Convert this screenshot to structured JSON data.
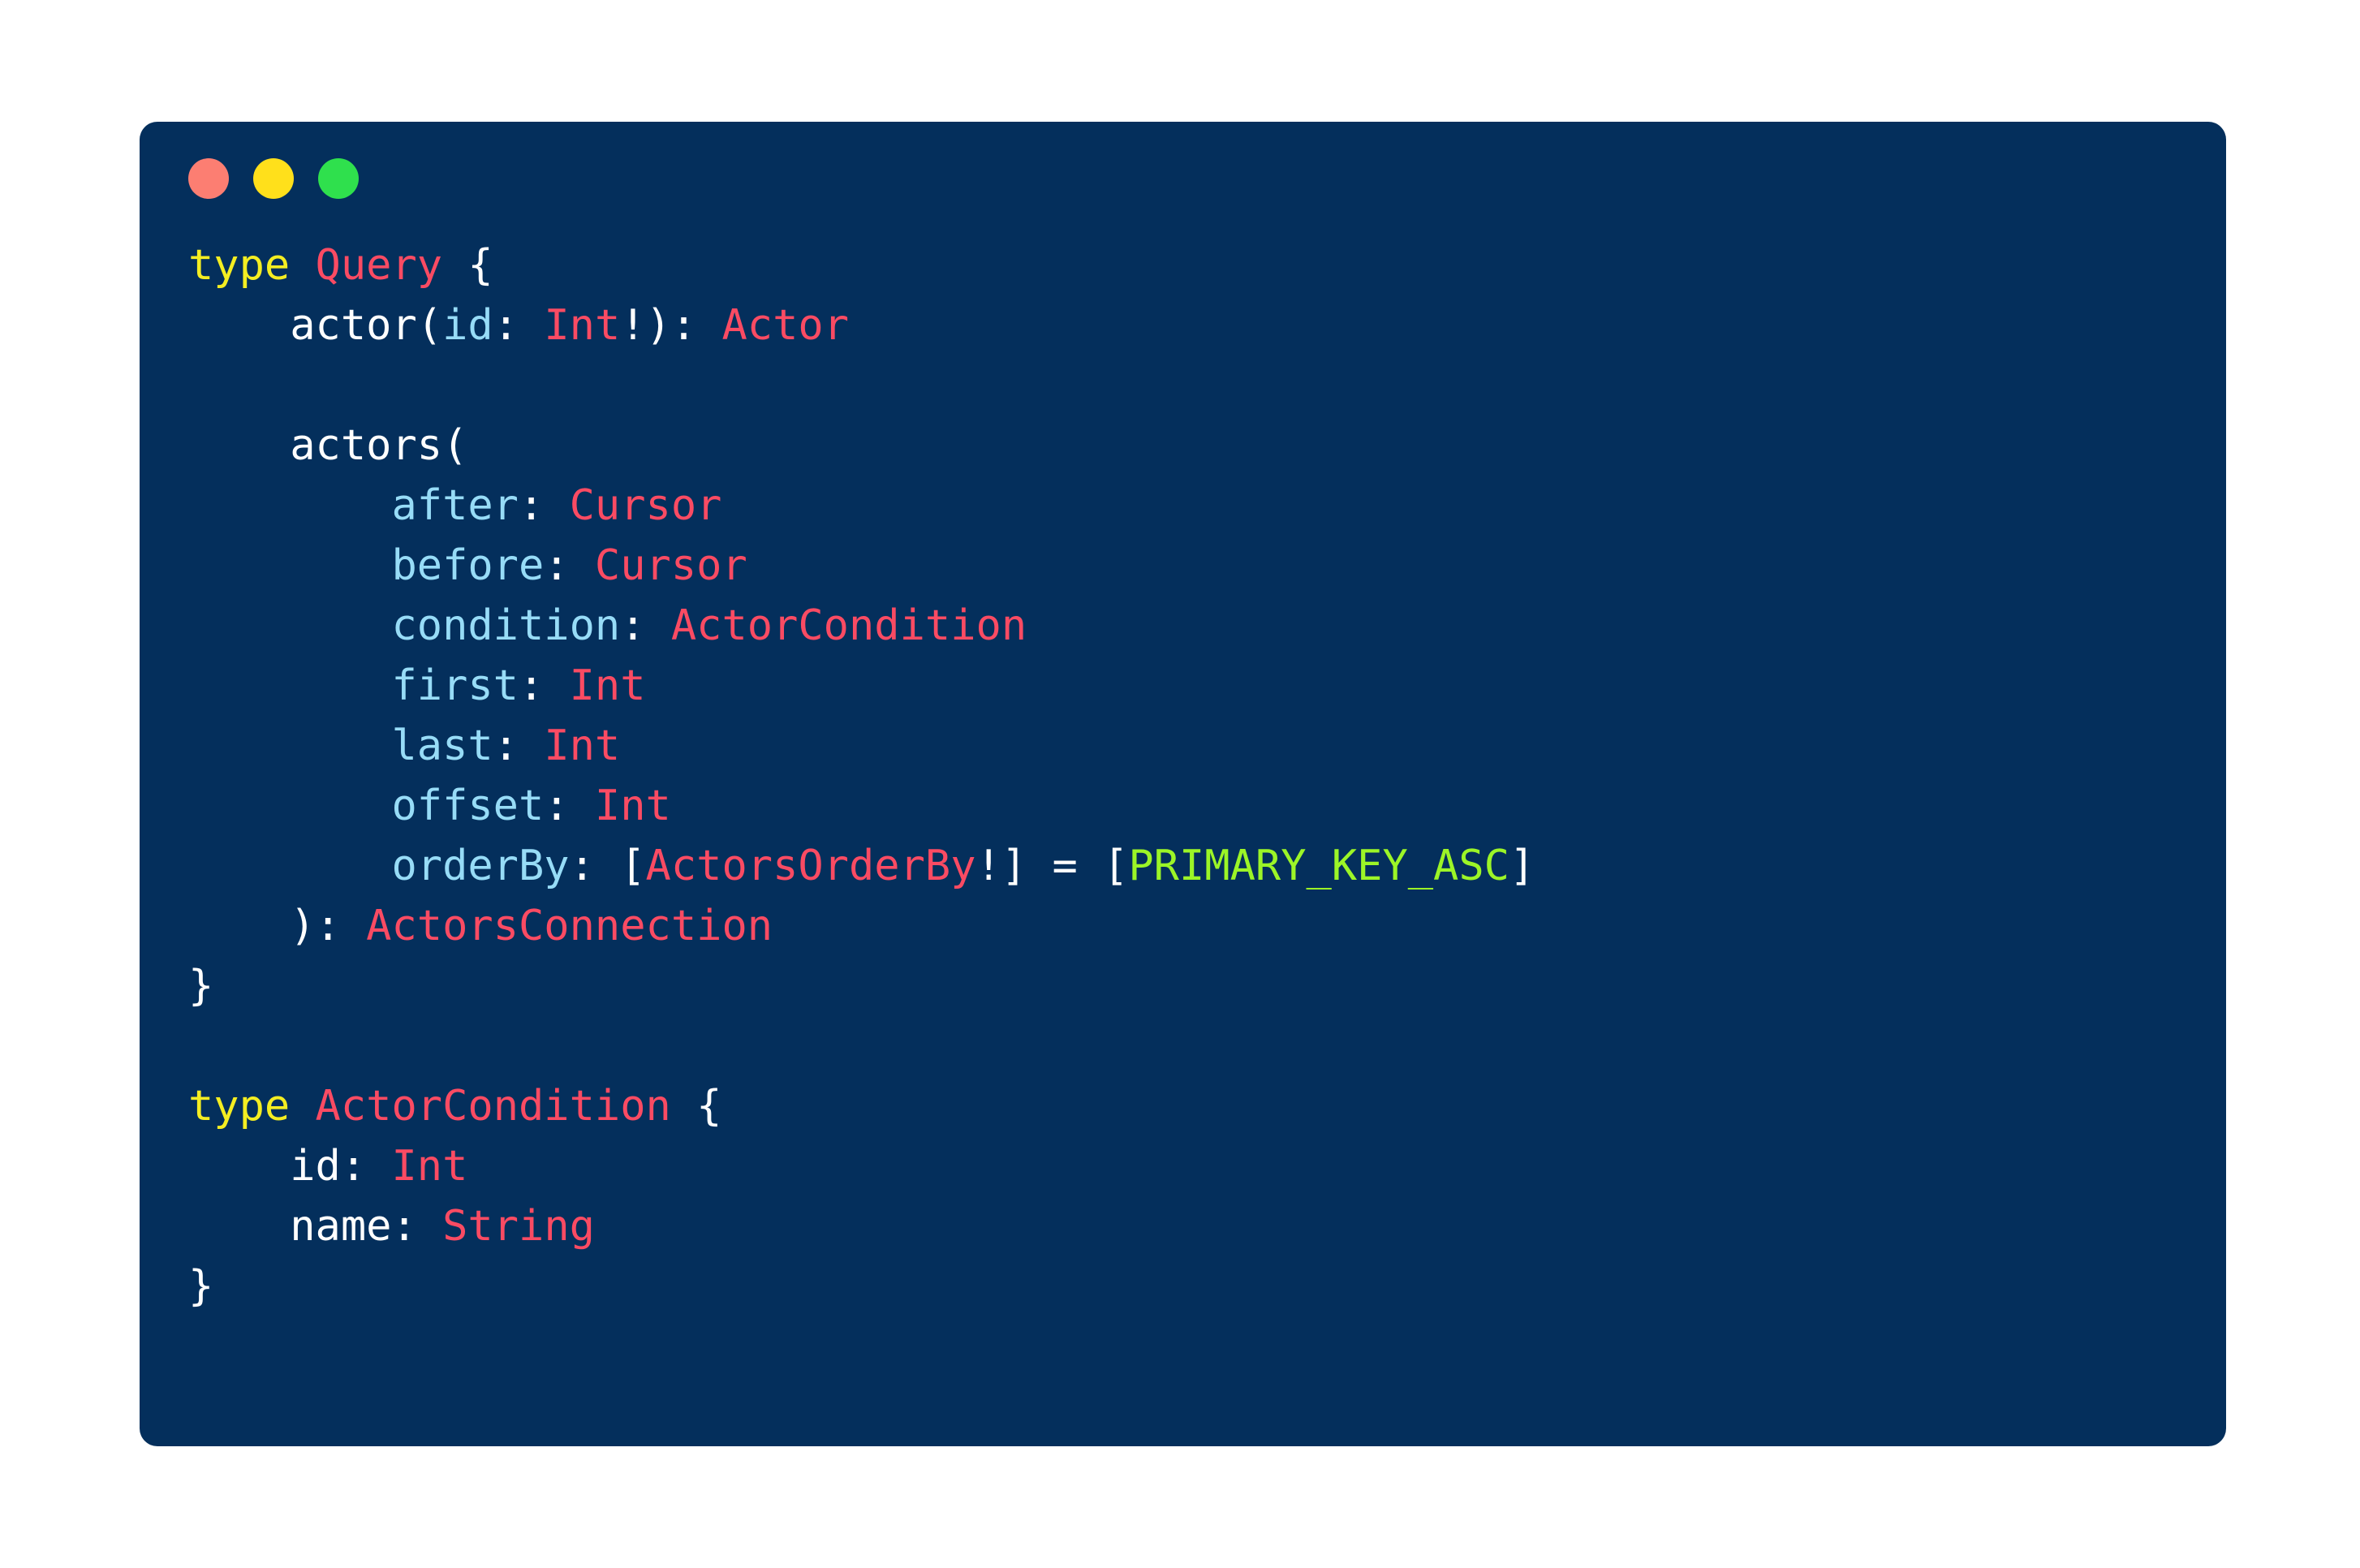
{
  "window": {
    "dots": [
      {
        "name": "close",
        "color": "#fc7e72"
      },
      {
        "name": "minimize",
        "color": "#ffe01b"
      },
      {
        "name": "maximize",
        "color": "#2fe04d"
      }
    ]
  },
  "theme": {
    "page_background": "#ffffff",
    "card_background": "#042f5c",
    "keyword": "#f4ed22",
    "type": "#fa4b63",
    "argument": "#97dcf7",
    "punctuation": "#ffffff",
    "enum_value": "#9cf527"
  },
  "code": {
    "language": "graphql",
    "lines": [
      {
        "indent": "",
        "tokens": [
          {
            "t": "type",
            "c": "kw"
          },
          {
            "t": " ",
            "c": "punct"
          },
          {
            "t": "Query",
            "c": "type"
          },
          {
            "t": " {",
            "c": "punct"
          }
        ]
      },
      {
        "indent": "    ",
        "tokens": [
          {
            "t": "actor",
            "c": "field"
          },
          {
            "t": "(",
            "c": "punct"
          },
          {
            "t": "id",
            "c": "arg"
          },
          {
            "t": ": ",
            "c": "punct"
          },
          {
            "t": "Int",
            "c": "type"
          },
          {
            "t": "!): ",
            "c": "punct"
          },
          {
            "t": "Actor",
            "c": "type"
          }
        ]
      },
      {
        "indent": "",
        "tokens": []
      },
      {
        "indent": "    ",
        "tokens": [
          {
            "t": "actors",
            "c": "field"
          },
          {
            "t": "(",
            "c": "punct"
          }
        ]
      },
      {
        "indent": "        ",
        "tokens": [
          {
            "t": "after",
            "c": "arg"
          },
          {
            "t": ": ",
            "c": "punct"
          },
          {
            "t": "Cursor",
            "c": "type"
          }
        ]
      },
      {
        "indent": "        ",
        "tokens": [
          {
            "t": "before",
            "c": "arg"
          },
          {
            "t": ": ",
            "c": "punct"
          },
          {
            "t": "Cursor",
            "c": "type"
          }
        ]
      },
      {
        "indent": "        ",
        "tokens": [
          {
            "t": "condition",
            "c": "arg"
          },
          {
            "t": ": ",
            "c": "punct"
          },
          {
            "t": "ActorCondition",
            "c": "type"
          }
        ]
      },
      {
        "indent": "        ",
        "tokens": [
          {
            "t": "first",
            "c": "arg"
          },
          {
            "t": ": ",
            "c": "punct"
          },
          {
            "t": "Int",
            "c": "type"
          }
        ]
      },
      {
        "indent": "        ",
        "tokens": [
          {
            "t": "last",
            "c": "arg"
          },
          {
            "t": ": ",
            "c": "punct"
          },
          {
            "t": "Int",
            "c": "type"
          }
        ]
      },
      {
        "indent": "        ",
        "tokens": [
          {
            "t": "offset",
            "c": "arg"
          },
          {
            "t": ": ",
            "c": "punct"
          },
          {
            "t": "Int",
            "c": "type"
          }
        ]
      },
      {
        "indent": "        ",
        "tokens": [
          {
            "t": "orderBy",
            "c": "arg"
          },
          {
            "t": ": [",
            "c": "punct"
          },
          {
            "t": "ActorsOrderBy",
            "c": "type"
          },
          {
            "t": "!] = [",
            "c": "punct"
          },
          {
            "t": "PRIMARY_KEY_ASC",
            "c": "enum"
          },
          {
            "t": "]",
            "c": "punct"
          }
        ]
      },
      {
        "indent": "    ",
        "tokens": [
          {
            "t": "): ",
            "c": "punct"
          },
          {
            "t": "ActorsConnection",
            "c": "type"
          }
        ]
      },
      {
        "indent": "",
        "tokens": [
          {
            "t": "}",
            "c": "punct"
          }
        ]
      },
      {
        "indent": "",
        "tokens": []
      },
      {
        "indent": "",
        "tokens": [
          {
            "t": "type",
            "c": "kw"
          },
          {
            "t": " ",
            "c": "punct"
          },
          {
            "t": "ActorCondition",
            "c": "type"
          },
          {
            "t": " {",
            "c": "punct"
          }
        ]
      },
      {
        "indent": "    ",
        "tokens": [
          {
            "t": "id",
            "c": "field"
          },
          {
            "t": ": ",
            "c": "punct"
          },
          {
            "t": "Int",
            "c": "type"
          }
        ]
      },
      {
        "indent": "    ",
        "tokens": [
          {
            "t": "name",
            "c": "field"
          },
          {
            "t": ": ",
            "c": "punct"
          },
          {
            "t": "String",
            "c": "type"
          }
        ]
      },
      {
        "indent": "",
        "tokens": [
          {
            "t": "}",
            "c": "punct"
          }
        ]
      }
    ]
  }
}
